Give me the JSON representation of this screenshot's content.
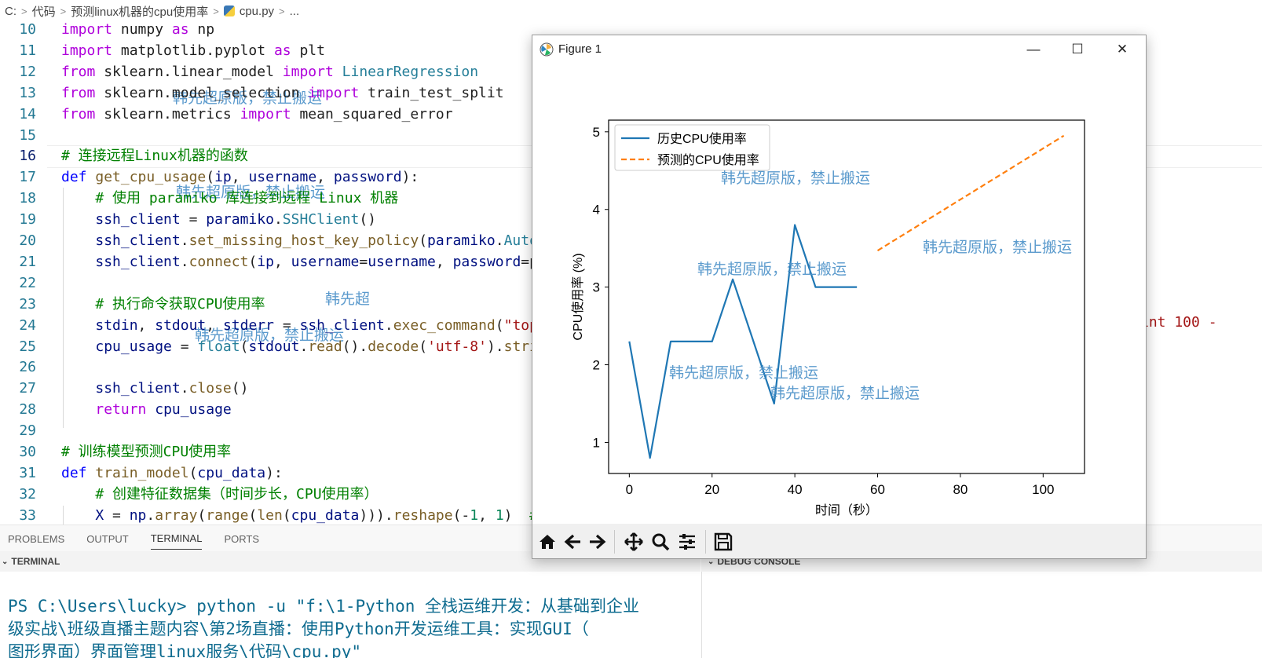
{
  "breadcrumb": {
    "root": "C:",
    "folder1": "代码",
    "folder2": "预测linux机器的cpu使用率",
    "file": "cpu.py",
    "more": "..."
  },
  "editor": {
    "lines": [
      {
        "n": "10",
        "tokens": [
          [
            "kc",
            "import"
          ],
          [
            "t",
            " numpy "
          ],
          [
            "kc",
            "as"
          ],
          [
            "t",
            " np"
          ]
        ]
      },
      {
        "n": "11",
        "tokens": [
          [
            "kc",
            "import"
          ],
          [
            "t",
            " matplotlib.pyplot "
          ],
          [
            "kc",
            "as"
          ],
          [
            "t",
            " plt"
          ]
        ]
      },
      {
        "n": "12",
        "tokens": [
          [
            "kc",
            "from"
          ],
          [
            "t",
            " sklearn.linear_model "
          ],
          [
            "kc",
            "import"
          ],
          [
            "t",
            " "
          ],
          [
            "cls",
            "LinearRegression"
          ]
        ]
      },
      {
        "n": "13",
        "tokens": [
          [
            "kc",
            "from"
          ],
          [
            "t",
            " sklearn.model_selection "
          ],
          [
            "kc",
            "import"
          ],
          [
            "t",
            " train_test_split"
          ]
        ]
      },
      {
        "n": "14",
        "tokens": [
          [
            "kc",
            "from"
          ],
          [
            "t",
            " sklearn.metrics "
          ],
          [
            "kc",
            "import"
          ],
          [
            "t",
            " mean_squared_error"
          ]
        ]
      },
      {
        "n": "15",
        "tokens": []
      },
      {
        "n": "16",
        "tokens": [
          [
            "cm",
            "# 连接远程Linux机器的函数"
          ]
        ]
      },
      {
        "n": "17",
        "tokens": [
          [
            "k",
            "def"
          ],
          [
            "t",
            " "
          ],
          [
            "fn",
            "get_cpu_usage"
          ],
          [
            "t",
            "("
          ],
          [
            "var",
            "ip"
          ],
          [
            "t",
            ", "
          ],
          [
            "var",
            "username"
          ],
          [
            "t",
            ", "
          ],
          [
            "var",
            "password"
          ],
          [
            "t",
            "):"
          ]
        ]
      },
      {
        "n": "18",
        "tokens": [
          [
            "t",
            "    "
          ],
          [
            "cm",
            "# 使用 paramiko 库连接到远程 Linux 机器"
          ]
        ]
      },
      {
        "n": "19",
        "tokens": [
          [
            "t",
            "    "
          ],
          [
            "var",
            "ssh_client"
          ],
          [
            "t",
            " = "
          ],
          [
            "var",
            "paramiko"
          ],
          [
            "t",
            "."
          ],
          [
            "cls",
            "SSHClient"
          ],
          [
            "t",
            "()"
          ]
        ]
      },
      {
        "n": "20",
        "tokens": [
          [
            "t",
            "    "
          ],
          [
            "var",
            "ssh_client"
          ],
          [
            "t",
            "."
          ],
          [
            "fn",
            "set_missing_host_key_policy"
          ],
          [
            "t",
            "("
          ],
          [
            "var",
            "paramiko"
          ],
          [
            "t",
            "."
          ],
          [
            "cls",
            "Auto"
          ]
        ]
      },
      {
        "n": "21",
        "tokens": [
          [
            "t",
            "    "
          ],
          [
            "var",
            "ssh_client"
          ],
          [
            "t",
            "."
          ],
          [
            "fn",
            "connect"
          ],
          [
            "t",
            "("
          ],
          [
            "var",
            "ip"
          ],
          [
            "t",
            ", "
          ],
          [
            "var",
            "username"
          ],
          [
            "t",
            "="
          ],
          [
            "var",
            "username"
          ],
          [
            "t",
            ", "
          ],
          [
            "var",
            "password"
          ],
          [
            "t",
            "=p"
          ]
        ]
      },
      {
        "n": "22",
        "tokens": []
      },
      {
        "n": "23",
        "tokens": [
          [
            "t",
            "    "
          ],
          [
            "cm",
            "# 执行命令获取CPU使用率"
          ]
        ]
      },
      {
        "n": "24",
        "tokens": [
          [
            "t",
            "    "
          ],
          [
            "var",
            "stdin"
          ],
          [
            "t",
            ", "
          ],
          [
            "var",
            "stdout"
          ],
          [
            "t",
            ", "
          ],
          [
            "var",
            "stderr"
          ],
          [
            "t",
            " = "
          ],
          [
            "var",
            "ssh_client"
          ],
          [
            "t",
            "."
          ],
          [
            "fn",
            "exec_command"
          ],
          [
            "t",
            "("
          ],
          [
            "str",
            "\"top"
          ]
        ]
      },
      {
        "n": "25",
        "tokens": [
          [
            "t",
            "    "
          ],
          [
            "var",
            "cpu_usage"
          ],
          [
            "t",
            " = "
          ],
          [
            "cls",
            "float"
          ],
          [
            "t",
            "("
          ],
          [
            "var",
            "stdout"
          ],
          [
            "t",
            "."
          ],
          [
            "fn",
            "read"
          ],
          [
            "t",
            "()."
          ],
          [
            "fn",
            "decode"
          ],
          [
            "t",
            "("
          ],
          [
            "str",
            "'utf-8'"
          ],
          [
            "t",
            ")."
          ],
          [
            "fn",
            "stri"
          ]
        ]
      },
      {
        "n": "26",
        "tokens": []
      },
      {
        "n": "27",
        "tokens": [
          [
            "t",
            "    "
          ],
          [
            "var",
            "ssh_client"
          ],
          [
            "t",
            "."
          ],
          [
            "fn",
            "close"
          ],
          [
            "t",
            "()"
          ]
        ]
      },
      {
        "n": "28",
        "tokens": [
          [
            "t",
            "    "
          ],
          [
            "kc",
            "return"
          ],
          [
            "t",
            " "
          ],
          [
            "var",
            "cpu_usage"
          ]
        ]
      },
      {
        "n": "29",
        "tokens": []
      },
      {
        "n": "30",
        "tokens": [
          [
            "cm",
            "# 训练模型预测CPU使用率"
          ]
        ]
      },
      {
        "n": "31",
        "tokens": [
          [
            "k",
            "def"
          ],
          [
            "t",
            " "
          ],
          [
            "fn",
            "train_model"
          ],
          [
            "t",
            "("
          ],
          [
            "var",
            "cpu_data"
          ],
          [
            "t",
            "):"
          ]
        ]
      },
      {
        "n": "32",
        "tokens": [
          [
            "t",
            "    "
          ],
          [
            "cm",
            "# 创建特征数据集（时间步长，CPU使用率）"
          ]
        ]
      },
      {
        "n": "33",
        "tokens": [
          [
            "t",
            "    "
          ],
          [
            "var",
            "X"
          ],
          [
            "t",
            " = "
          ],
          [
            "var",
            "np"
          ],
          [
            "t",
            "."
          ],
          [
            "fn",
            "array"
          ],
          [
            "t",
            "("
          ],
          [
            "fn",
            "range"
          ],
          [
            "t",
            "("
          ],
          [
            "fn",
            "len"
          ],
          [
            "t",
            "("
          ],
          [
            "var",
            "cpu_data"
          ],
          [
            "t",
            ")))."
          ],
          [
            "fn",
            "reshape"
          ],
          [
            "t",
            "(-"
          ],
          [
            "num",
            "1"
          ],
          [
            "t",
            ", "
          ],
          [
            "num",
            "1"
          ],
          [
            "t",
            ")  "
          ],
          [
            "cm",
            "#"
          ]
        ]
      }
    ],
    "right_fragment": "int 100 -",
    "watermarks": {
      "w1": "韩先超原版，禁止搬运",
      "w2": "韩先超原版，禁止搬运",
      "w3": "韩先超",
      "w4": "韩先超原版，禁止搬运"
    }
  },
  "panel": {
    "tabs": [
      "PROBLEMS",
      "OUTPUT",
      "TERMINAL",
      "PORTS"
    ],
    "active_tab": "TERMINAL",
    "terminal_header": "TERMINAL",
    "debug_header": "DEBUG CONSOLE",
    "terminal_lines": [
      "PS C:\\Users\\lucky> python -u \"f:\\1-Python 全栈运维开发：从基础到企业",
      "级实战\\班级直播主题内容\\第2场直播：使用Python开发运维工具：实现GUI（",
      "图形界面）界面管理linux服务\\代码\\cpu.py\""
    ]
  },
  "figure": {
    "title": "Figure 1",
    "controls": {
      "minimize": "—",
      "maximize": "☐",
      "close": "✕"
    },
    "toolbar_icons": [
      "home-icon",
      "back-arrow-icon",
      "forward-arrow-icon",
      "pan-icon",
      "zoom-icon",
      "configure-subplots-icon",
      "save-icon"
    ],
    "watermarks": {
      "w1": "韩先超原版，禁止搬运",
      "w2": "韩先超原版，禁止搬运",
      "w3": "韩先超原版，禁止搬运",
      "w4": "韩先超原版，禁止搬运",
      "w5": "韩先超原版，禁止搬运"
    },
    "colors": {
      "history": "#1f77b4",
      "predicted": "#ff7f0e"
    }
  },
  "chart_data": {
    "type": "line",
    "xlabel": "时间（秒）",
    "ylabel": "CPU使用率 (%)",
    "xlim": [
      -5,
      110
    ],
    "ylim": [
      0.6,
      5.15
    ],
    "xticks": [
      0,
      20,
      40,
      60,
      80,
      100
    ],
    "yticks": [
      1,
      2,
      3,
      4,
      5
    ],
    "legend": "top-left",
    "series": [
      {
        "name": "历史CPU使用率",
        "style": "solid",
        "color": "#1f77b4",
        "x": [
          0,
          5,
          10,
          15,
          20,
          25,
          30,
          35,
          40,
          45,
          50,
          55
        ],
        "y": [
          2.3,
          0.8,
          2.3,
          2.3,
          2.3,
          3.1,
          2.3,
          1.5,
          3.8,
          3.0,
          3.0,
          3.0
        ]
      },
      {
        "name": "预测的CPU使用率",
        "style": "dashed",
        "color": "#ff7f0e",
        "x": [
          60,
          105
        ],
        "y": [
          3.47,
          4.95
        ]
      }
    ]
  }
}
